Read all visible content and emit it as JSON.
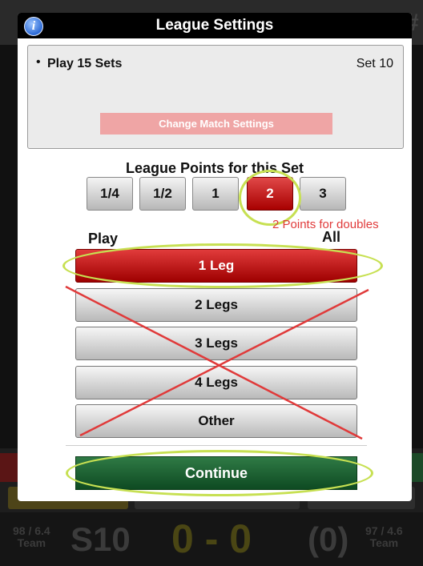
{
  "dialog": {
    "title": "League Settings",
    "info_icon_glyph": "i",
    "settings": {
      "item": "Play 15 Sets",
      "set_label": "Set 10",
      "change_button": "Change Match Settings"
    },
    "points_title": "League Points for this Set",
    "points_options": [
      "1/4",
      "1/2",
      "1",
      "2",
      "3"
    ],
    "selected_points": "2",
    "annotation_text": "2 Points for doubles",
    "play_label": "Play",
    "all_label": "All",
    "leg_options": [
      "1 Leg",
      "2 Legs",
      "3 Legs",
      "4 Legs",
      "Other"
    ],
    "selected_leg": "1 Leg",
    "continue_label": "Continue"
  },
  "background": {
    "team_left_line1": "98 / 6.4",
    "team_left_line2": "Team",
    "set": "S10",
    "score": "0 - 0",
    "bracket": "(0)",
    "team_right_line1": "97 / 4.6",
    "team_right_line2": "Team",
    "hash": "#"
  },
  "colors": {
    "selected_red": "#c00000",
    "continue_green": "#1f6a36",
    "annotation_green": "#c7e052",
    "annotation_red": "#e03a3a"
  }
}
